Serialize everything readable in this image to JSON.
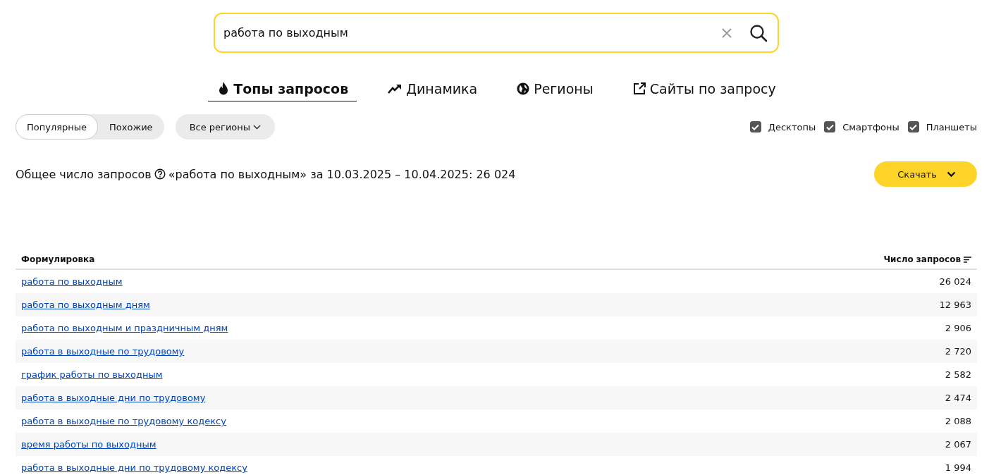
{
  "search": {
    "value": "работа по выходным"
  },
  "tabs": [
    {
      "label": "Топы запросов",
      "selected": true
    },
    {
      "label": "Динамика",
      "selected": false
    },
    {
      "label": "Регионы",
      "selected": false
    },
    {
      "label": "Сайты по запросу",
      "selected": false
    }
  ],
  "mode_switch": [
    {
      "label": "Популярные",
      "selected": true
    },
    {
      "label": "Похожие",
      "selected": false
    }
  ],
  "region_dropdown": {
    "label": "Все регионы"
  },
  "devices": [
    {
      "label": "Десктопы",
      "checked": true
    },
    {
      "label": "Смартфоны",
      "checked": true
    },
    {
      "label": "Планшеты",
      "checked": true
    }
  ],
  "summary": {
    "label": "Общее число запросов",
    "text": "«работа по выходным» за 10.03.2025 – 10.04.2025: 26 024"
  },
  "download_button": {
    "label": "Скачать"
  },
  "table": {
    "columns": [
      "Формулировка",
      "Число запросов"
    ],
    "rows": [
      {
        "phrase": "работа по выходным",
        "count": "26 024"
      },
      {
        "phrase": "работа по выходным дням",
        "count": "12 963"
      },
      {
        "phrase": "работа по выходным и праздничным дням",
        "count": "2 906"
      },
      {
        "phrase": "работа в выходные по трудовому",
        "count": "2 720"
      },
      {
        "phrase": "график работы по выходным",
        "count": "2 582"
      },
      {
        "phrase": "работа в выходные дни по трудовому",
        "count": "2 474"
      },
      {
        "phrase": "работа в выходные по трудовому кодексу",
        "count": "2 088"
      },
      {
        "phrase": "время работы по выходным",
        "count": "2 067"
      },
      {
        "phrase": "работа в выходные дни по трудовому кодексу",
        "count": "1 994"
      }
    ]
  }
}
